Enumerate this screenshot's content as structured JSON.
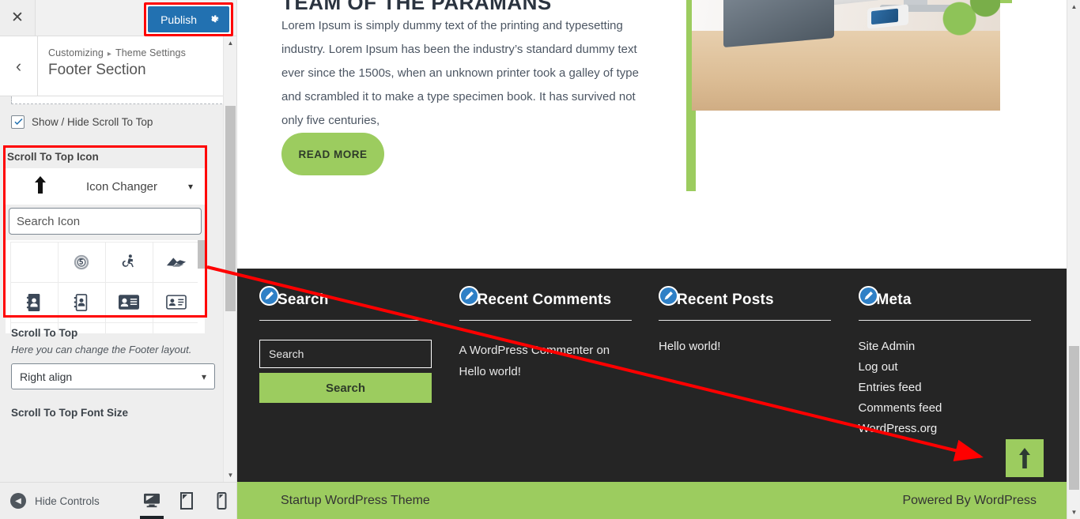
{
  "customizer": {
    "close_icon": "close-icon",
    "publish_label": "Publish",
    "gear_icon": "gear-icon",
    "back_icon": "chevron-left-icon",
    "breadcrumb_root": "Customizing",
    "breadcrumb_sep": "▸",
    "breadcrumb_parent": "Theme Settings",
    "panel_title": "Footer Section",
    "accent_blue": "#2271b1",
    "highlight_red": "#ff0000",
    "checkbox": {
      "label": "Show / Hide Scroll To Top",
      "checked": true
    },
    "icon_control": {
      "label": "Scroll To Top Icon",
      "current_icon": "arrow-up-icon",
      "changer_label": "Icon Changer",
      "caret_icon": "chevron-down-icon",
      "search_placeholder": "Search Icon",
      "search_value": "",
      "grid": [
        {
          "name": "blank-icon",
          "glyph": ""
        },
        {
          "name": "fingerprint-500px-icon",
          "glyph": "500px"
        },
        {
          "name": "accessible-icon",
          "glyph": "wheelchair"
        },
        {
          "name": "accusoft-icon",
          "glyph": "accusoft"
        },
        {
          "name": "address-book-solid-icon",
          "glyph": "address-book"
        },
        {
          "name": "address-book-regular-icon",
          "glyph": "address-book-o"
        },
        {
          "name": "address-card-solid-icon",
          "glyph": "address-card"
        },
        {
          "name": "address-card-regular-icon",
          "glyph": "address-card-o"
        },
        {
          "name": "adjust-icon",
          "glyph": "adjust"
        },
        {
          "name": "arrow-alt-circle-up-icon",
          "glyph": "circle-up"
        },
        {
          "name": "adversal-ad-icon",
          "glyph": "ad"
        },
        {
          "name": "affiliatetheme-icon",
          "glyph": "swoosh"
        }
      ]
    },
    "layout_control": {
      "label": "Scroll To Top",
      "description": "Here you can change the Footer layout.",
      "selected": "Right align",
      "caret_icon": "chevron-down-icon"
    },
    "font_size_label": "Scroll To Top Font Size",
    "footer": {
      "hide_controls_label": "Hide Controls",
      "hide_controls_icon": "chevron-left-circle-icon",
      "devices": [
        {
          "name": "device-desktop",
          "icon": "desktop-icon",
          "active": true
        },
        {
          "name": "device-tablet",
          "icon": "tablet-icon",
          "active": false
        },
        {
          "name": "device-mobile",
          "icon": "mobile-icon",
          "active": false
        }
      ]
    }
  },
  "preview": {
    "hero": {
      "heading": "TEAM OF THE PARAMANS",
      "paragraph": "Lorem Ipsum is simply dummy text of the printing and typesetting industry. Lorem Ipsum has been the industry’s standard dummy text ever since the 1500s, when an unknown printer took a galley of type and scrambled it to make a type specimen book. It has survived not only five centuries,",
      "cta_label": "READ MORE",
      "photo_alt": "desk-workspace-photo"
    },
    "theme_green": "#9ccc5f",
    "footer_bg": "#252525",
    "widgets": [
      {
        "name": "widget-search",
        "title": "Search",
        "edit_icon": "edit-pencil-icon",
        "type": "search",
        "search_placeholder": "Search",
        "search_value": "",
        "submit_label": "Search"
      },
      {
        "name": "widget-recent-comments",
        "title": "Recent Comments",
        "edit_icon": "edit-pencil-icon",
        "type": "text",
        "text": "A WordPress Commenter on Hello world!"
      },
      {
        "name": "widget-recent-posts",
        "title": "Recent Posts",
        "edit_icon": "edit-pencil-icon",
        "type": "list",
        "items": [
          "Hello world!"
        ]
      },
      {
        "name": "widget-meta",
        "title": "Meta",
        "edit_icon": "edit-pencil-icon",
        "type": "list",
        "items": [
          "Site Admin",
          "Log out",
          "Entries feed",
          "Comments feed",
          "WordPress.org"
        ]
      }
    ],
    "scroll_top_button": {
      "name": "scroll-to-top-button",
      "icon": "arrow-up-icon"
    },
    "bottom_bar": {
      "left": "Startup WordPress Theme",
      "right": "Powered By WordPress"
    }
  },
  "annotation": {
    "arrow_color": "#ff0000",
    "description": "red arrow from icon picker to scroll-to-top button"
  }
}
